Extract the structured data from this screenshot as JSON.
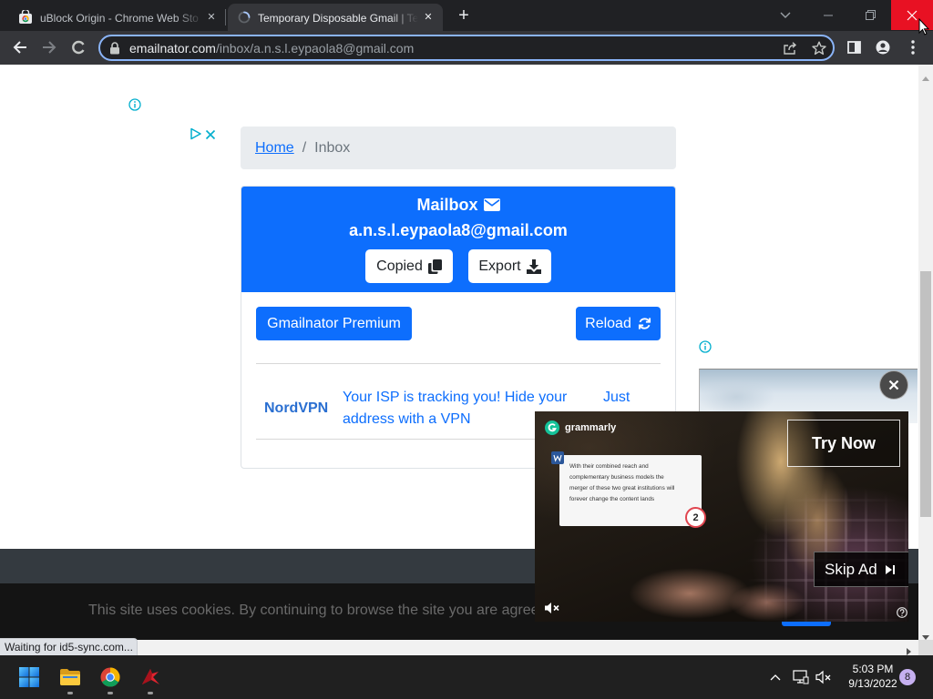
{
  "browser": {
    "tabs": [
      {
        "title": "uBlock Origin - Chrome Web Sto",
        "icon": "chrome-web-store-icon",
        "active": false
      },
      {
        "title": "Temporary Disposable Gmail | Te",
        "icon": "loading-spinner-icon",
        "active": true
      }
    ],
    "new_tab_label": "+",
    "address": {
      "domain": "emailnator.com",
      "path": "/inbox/a.n.s.l.eypaola8@gmail.com"
    },
    "status_text": "Waiting for id5-sync.com..."
  },
  "page": {
    "breadcrumb": {
      "home": "Home",
      "separator": "/",
      "current": "Inbox"
    },
    "mailbox": {
      "title": "Mailbox",
      "title_icon": "envelope-icon",
      "email": "a.n.s.l.eypaola8@gmail.com",
      "copy_label": "Copied",
      "copy_icon": "copy-icon",
      "export_label": "Export",
      "export_icon": "download-icon"
    },
    "actions": {
      "premium_label": "Gmailnator Premium",
      "reload_label": "Reload",
      "reload_icon": "sync-icon"
    },
    "messages": [
      {
        "from": "NordVPN",
        "subject": "Your ISP is tracking you! Hide your address with a VPN",
        "time": "Just"
      }
    ],
    "cookie_notice": "This site uses cookies. By continuing to browse the site you are agree"
  },
  "video_ad": {
    "brand": "grammarly",
    "doc_lines": [
      "With their combined reach and",
      "complementary business models the",
      "merger of these two great institutions will",
      "forever change the content lands"
    ],
    "suggestion_count": "2",
    "cta_label": "Try Now",
    "skip_label": "Skip Ad"
  },
  "taskbar": {
    "apps": [
      "start-icon",
      "file-explorer-icon",
      "chrome-icon",
      "red-app-icon"
    ],
    "tray_icons": [
      "chevron-up-icon",
      "network-icon",
      "volume-muted-icon"
    ],
    "time": "5:03 PM",
    "date": "9/13/2022",
    "notification_count": "8"
  },
  "colors": {
    "primary": "#0d6efd",
    "tab_strip": "#202124",
    "toolbar": "#35363a",
    "close_button": "#e81123",
    "ad_info": "#00aecd",
    "taskbar": "#202020",
    "notification_badge": "#c6b0f0"
  }
}
